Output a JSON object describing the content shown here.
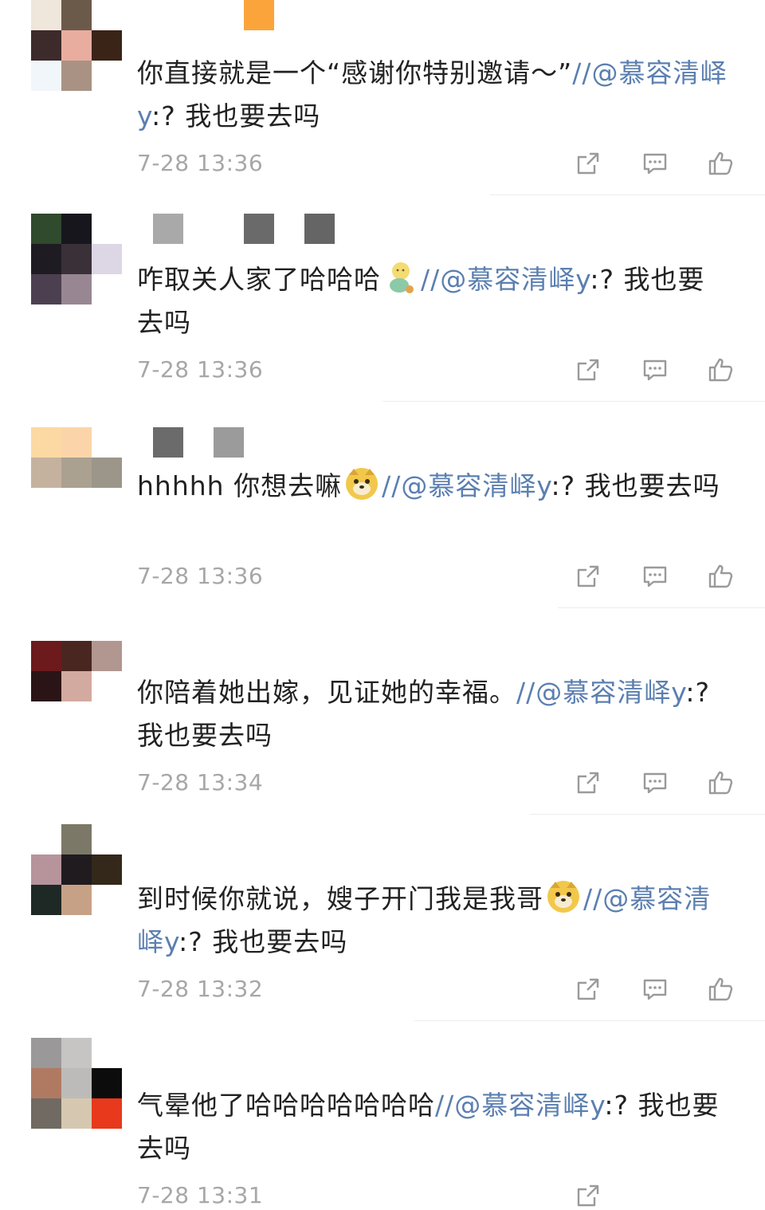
{
  "comments": [
    {
      "text_before": "你直接就是一个“感谢你特别邀请～”",
      "mention": "//@慕容清峄y",
      "text_after": ":? 我也要去吗",
      "time": "7-28 13:36"
    },
    {
      "text_before": "咋取关人家了哈哈哈",
      "emoji": "baby-emoji",
      "mention": "//@慕容清峄y",
      "text_after": ":? 我也要去吗",
      "time": "7-28 13:36"
    },
    {
      "text_before": "hhhhh 你想去嘛",
      "emoji": "doge-emoji",
      "mention": "//@慕容清峄y",
      "text_after": ":? 我也要去吗",
      "time": "7-28 13:36"
    },
    {
      "text_before": "你陪着她出嫁，见证她的幸福。",
      "mention": "//@慕容清峄y",
      "text_after": ":? 我也要去吗",
      "time": "7-28 13:34"
    },
    {
      "text_before": "到时候你就说，嫂子开门我是我哥",
      "emoji": "doge-emoji",
      "mention": "//@慕容清峄y",
      "text_after": ":? 我也要去吗",
      "time": "7-28 13:32"
    },
    {
      "text_before": "气晕他了哈哈哈哈哈哈哈",
      "mention": "//@慕容清峄y",
      "text_after": ":? 我也要去吗",
      "time": "7-28 13:31"
    }
  ],
  "icons": {
    "share": "share-icon",
    "comment": "comment-icon",
    "like": "thumbs-up-icon"
  },
  "colors": {
    "mention": "#5b7fb0",
    "time": "#a7a7a7",
    "icon": "#9a9a9a",
    "divider": "#ececec"
  }
}
